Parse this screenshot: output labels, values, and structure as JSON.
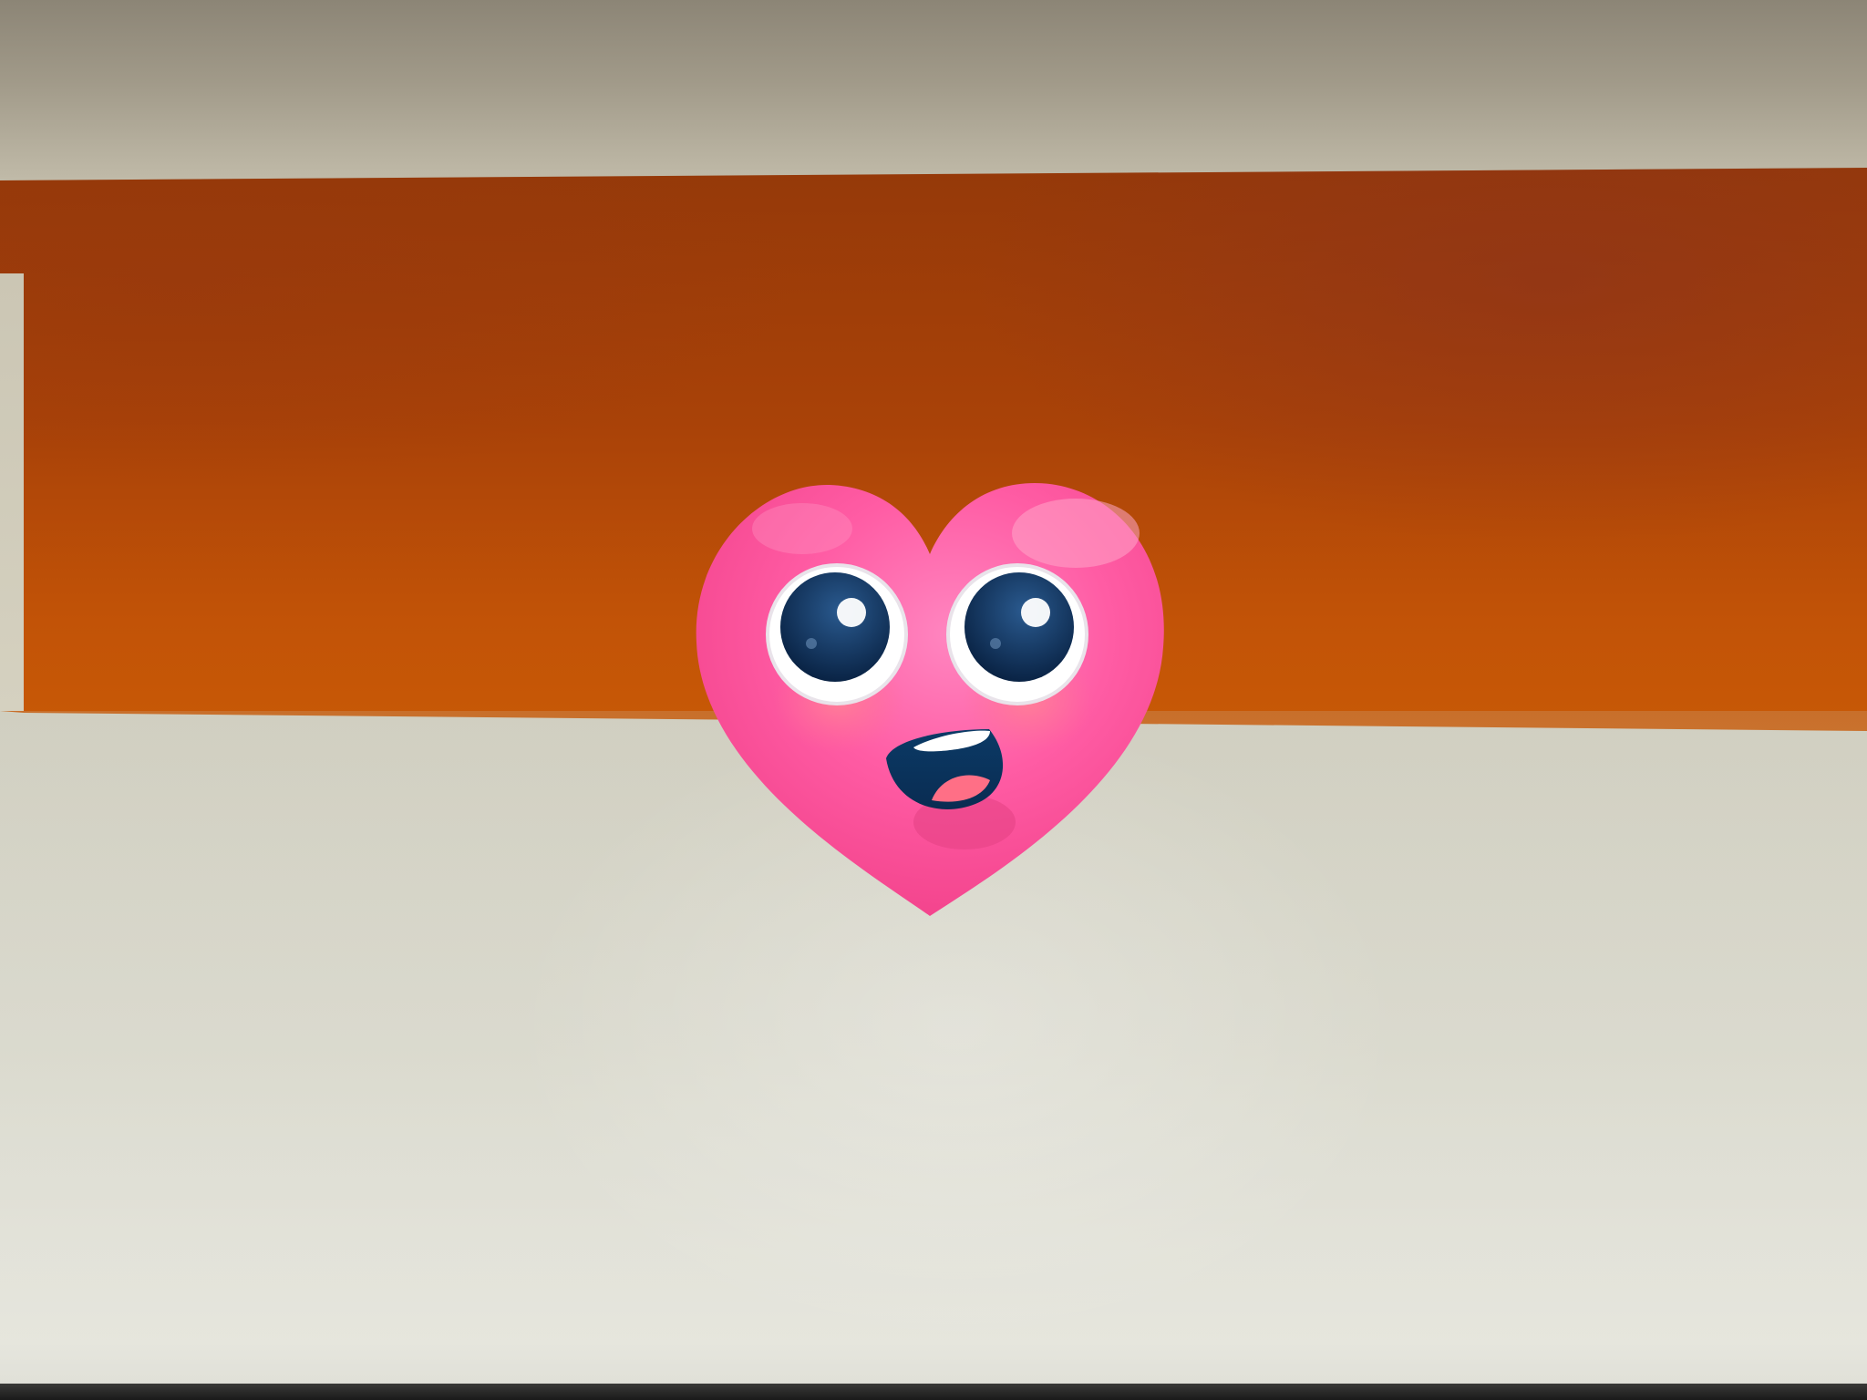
{
  "colors": {
    "banner": "#b24a06",
    "background": "#d2d1c4",
    "heart": "#ff4f96",
    "eyes": "#0b2e56"
  },
  "mascot": {
    "icon": "heart-face-icon",
    "expression": "happy"
  }
}
